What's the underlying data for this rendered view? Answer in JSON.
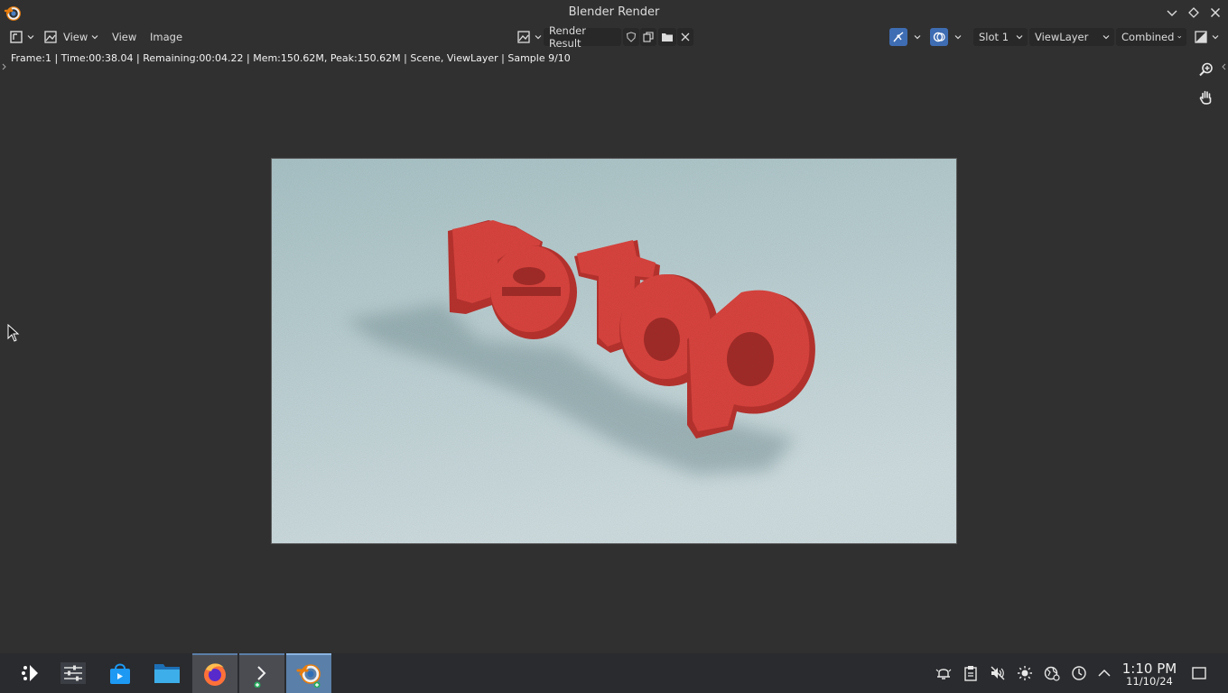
{
  "window": {
    "title": "Blender Render",
    "app_icon": "blender-icon"
  },
  "header": {
    "editor_type_icon": "image-editor-icon",
    "view_menu_dropdown": "View",
    "menus": [
      "View",
      "Image"
    ],
    "image_browse_icon": "image-browse-icon",
    "image_name": "Render Result",
    "slot": "Slot 1",
    "view_layer": "ViewLayer",
    "pass": "Combined"
  },
  "status": {
    "text": "Frame:1 | Time:00:38.04 | Remaining:00:04.22 | Mem:150.62M, Peak:150.62M | Scene, ViewLayer | Sample 9/10"
  },
  "render": {
    "text": "retap",
    "colors": {
      "background_top": "#a9c3c6",
      "background_bottom": "#cfdde0",
      "letters": "#d9443f",
      "letters_dark": "#b8332f",
      "shadow": "#8aa4a8"
    }
  },
  "taskbar": {
    "items": [
      "app-launcher-icon",
      "system-settings-icon",
      "discover-store-icon",
      "file-manager-icon",
      "firefox-icon",
      "terminal-icon",
      "blender-icon"
    ]
  },
  "tray": {
    "icons": [
      "notifications-icon",
      "clipboard-icon",
      "volume-muted-icon",
      "brightness-icon",
      "network-icon",
      "power-icon",
      "show-hidden-icon"
    ]
  },
  "clock": {
    "time": "1:10 PM",
    "date": "11/10/24"
  },
  "colors": {
    "accent_blue": "#3f6db3",
    "window_bg": "#303030",
    "taskbar_bg": "#2a2b2e"
  }
}
